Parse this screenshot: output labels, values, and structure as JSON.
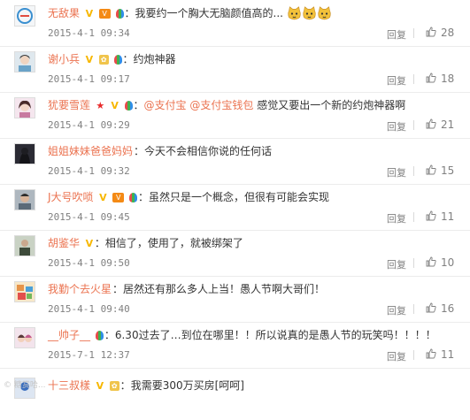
{
  "comments": [
    {
      "user": "无敌果",
      "text": "我要约一个胸大无脑颜值高的...",
      "time": "2015-4-1 09:34",
      "reply": "回复",
      "likes": "28",
      "avatar_color": "#3a8fd0"
    },
    {
      "user": "谢小兵",
      "text": "约炮神器",
      "time": "2015-4-1 09:17",
      "reply": "回复",
      "likes": "18",
      "avatar_color": "#6aa3c8"
    },
    {
      "user": "犹要雪莲",
      "mentions": [
        "@支付宝",
        "@支付宝钱包"
      ],
      "text": "感觉又要出一个新的约炮神器啊",
      "time": "2015-4-1 09:29",
      "reply": "回复",
      "likes": "21",
      "avatar_color": "#c87aa0"
    },
    {
      "user": "姐姐妹妹爸爸妈妈",
      "text": "今天不会相信你说的任何话",
      "time": "2015-4-1 09:32",
      "reply": "回复",
      "likes": "15",
      "avatar_color": "#2b2b34"
    },
    {
      "user": "J大号吹唢",
      "text": "虽然只是一个概念，但很有可能会实现",
      "time": "2015-4-1 09:45",
      "reply": "回复",
      "likes": "11",
      "avatar_color": "#5b6a78"
    },
    {
      "user": "胡鉴华",
      "text": "相信了，使用了，就被绑架了",
      "time": "2015-4-1 09:50",
      "reply": "回复",
      "likes": "10",
      "avatar_color": "#3d4a3a"
    },
    {
      "user": "我勤个去火星",
      "text": "居然还有那么多人上当！愚人节啊大哥们！",
      "time": "2015-4-1 09:40",
      "reply": "回复",
      "likes": "16",
      "avatar_color": "#e6944a"
    },
    {
      "user": "__帅子__",
      "text": "6.30过去了…到位在哪里！！所以说真的是愚人节的玩笑吗！！！！",
      "time": "2015-7-1 12:37",
      "reply": "回复",
      "likes": "11",
      "avatar_color": "#c35a8c"
    },
    {
      "user": "十三叔樣",
      "text": "我需要300万买房[呵呵]",
      "time": "",
      "reply": "",
      "likes": "",
      "avatar_color": "#3b6fbf"
    }
  ],
  "icons": {
    "like": "thumb-up-icon",
    "emoji": "cat-face-emoji-icon",
    "v": "verified-v-icon",
    "vip": "vip-icon",
    "balloon": "balloon-icon",
    "star": "star-icon"
  },
  "watermark": "© 糖赏哈..."
}
